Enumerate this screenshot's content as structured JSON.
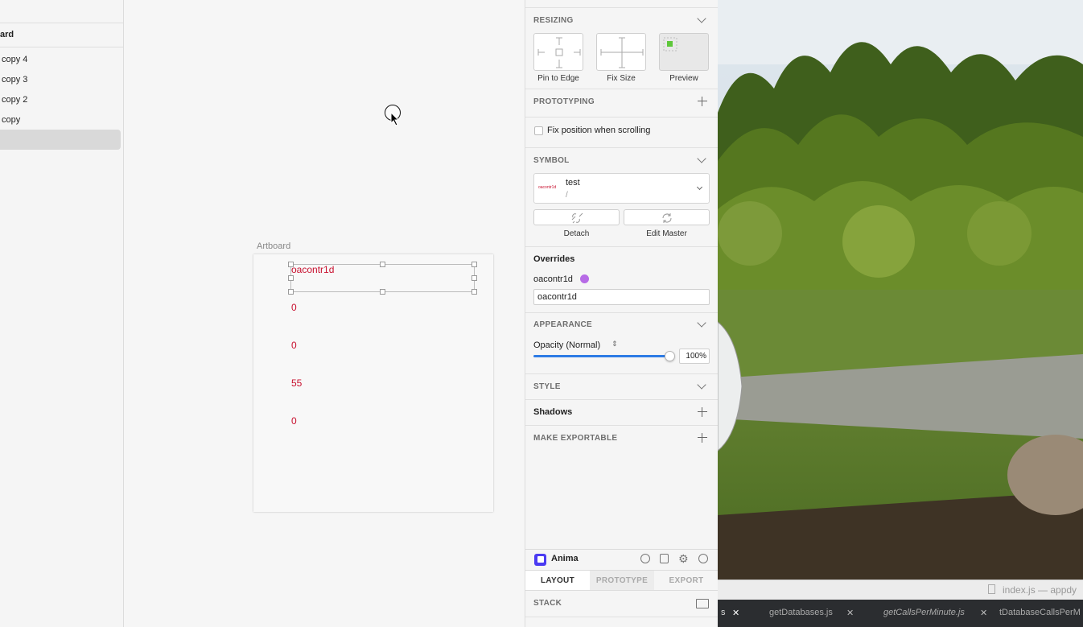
{
  "layers": {
    "page_name": "ard",
    "items": [
      {
        "label": "copy 4"
      },
      {
        "label": "copy 3"
      },
      {
        "label": "copy 2"
      },
      {
        "label": "copy"
      }
    ]
  },
  "canvas": {
    "artboard_label": "Artboard",
    "artboard_texts": [
      "oacontr1d",
      "0",
      "0",
      "55",
      "0"
    ]
  },
  "inspector": {
    "resizing": {
      "title": "RESIZING",
      "options": [
        "Pin to Edge",
        "Fix Size",
        "Preview"
      ]
    },
    "prototyping": {
      "title": "PROTOTYPING",
      "fix_position_label": "Fix position when scrolling"
    },
    "symbol": {
      "title": "SYMBOL",
      "name": "test",
      "path": "/",
      "thumb_text": "oacontr1d",
      "detach_label": "Detach",
      "edit_master_label": "Edit Master"
    },
    "overrides": {
      "title": "Overrides",
      "field_label": "oacontr1d",
      "field_value": "oacontr1d"
    },
    "appearance": {
      "title": "APPEARANCE",
      "opacity_label": "Opacity (Normal)",
      "opacity_value": "100%",
      "opacity_fraction": 1.0
    },
    "style": {
      "title": "STYLE"
    },
    "shadows": {
      "title": "Shadows"
    },
    "exportable": {
      "title": "MAKE EXPORTABLE"
    },
    "anima": {
      "title": "Anima",
      "tabs": [
        "LAYOUT",
        "PROTOTYPE",
        "EXPORT"
      ],
      "stack_label": "STACK"
    }
  },
  "window": {
    "title": "index.js — appdy",
    "editor_tabs": [
      "s",
      "getDatabases.js",
      "getCallsPerMinute.js",
      "tDatabaseCallsPerM"
    ]
  },
  "colors": {
    "accent": "#2d7be5",
    "artboard_text": "#c8102e",
    "anima_brand": "#4b3bf2"
  }
}
